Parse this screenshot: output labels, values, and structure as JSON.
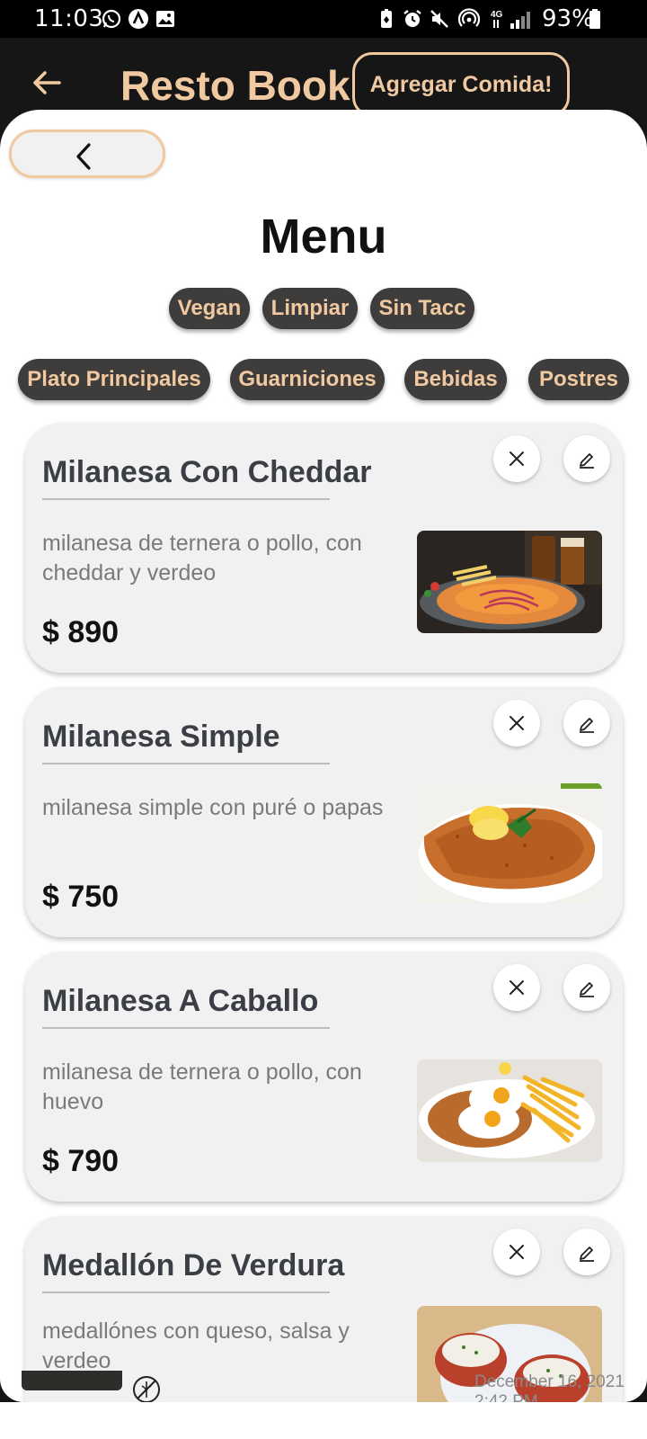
{
  "status_bar": {
    "time": "11:03",
    "battery": "93%",
    "icons": [
      "whatsapp-icon",
      "arch-app-icon",
      "gallery-icon",
      "battery-saver-icon",
      "alarm-icon",
      "mute-icon",
      "hotspot-icon",
      "4g-signal-icon",
      "battery-icon"
    ]
  },
  "app_bar": {
    "title": "Resto Book",
    "add_food_label": "Agregar Comida!",
    "back_icon": "arrow-left-icon"
  },
  "page": {
    "title": "Menu",
    "back_icon": "chevron-left-icon"
  },
  "filters": [
    "Vegan",
    "Limpiar",
    "Sin Tacc"
  ],
  "categories": [
    "Plato Principales",
    "Guarniciones",
    "Bebidas",
    "Postres"
  ],
  "items": [
    {
      "name": "Milanesa Con Cheddar",
      "description": "milanesa de ternera o pollo, con cheddar y verdeo",
      "price": "$ 890"
    },
    {
      "name": "Milanesa Simple",
      "description": "milanesa simple con puré o papas",
      "price": "$ 750"
    },
    {
      "name": "Milanesa A Caballo",
      "description": "milanesa de ternera o pollo, con huevo",
      "price": "$ 790"
    },
    {
      "name": "Medallón De Verdura",
      "description": "medallónes con queso, salsa y verdeo",
      "price": ""
    }
  ],
  "background_footer": {
    "date_line1": "December 16, 2021",
    "date_line2": "2:42 PM"
  },
  "colors": {
    "accent": "#f1c9a1",
    "chip_bg": "#3f3d3c",
    "card_bg": "#f1f1f1",
    "app_bar_bg": "#161616"
  }
}
